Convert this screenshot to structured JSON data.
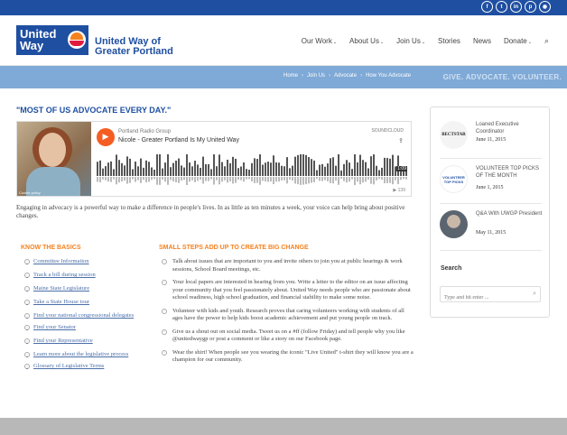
{
  "social": [
    "f",
    "t",
    "in",
    "p",
    "rss"
  ],
  "social_icons": [
    "facebook-icon",
    "twitter-icon",
    "linkedin-icon",
    "pinterest-icon",
    "rss-icon"
  ],
  "logo": {
    "text": "United Way",
    "org_name": "United Way of Greater Portland"
  },
  "nav": [
    {
      "label": "Our Work",
      "dropdown": true
    },
    {
      "label": "About Us",
      "dropdown": true
    },
    {
      "label": "Join Us",
      "dropdown": true
    },
    {
      "label": "Stories",
      "dropdown": false
    },
    {
      "label": "News",
      "dropdown": false
    },
    {
      "label": "Donate",
      "dropdown": true
    }
  ],
  "breadcrumb": [
    "Home",
    "Join Us",
    "Advocate",
    "How You Advocate"
  ],
  "tagline": "GIVE. ADVOCATE. VOLUNTEER.",
  "page_title": "\"MOST OF US ADVOCATE EVERY DAY.\"",
  "player": {
    "group": "Portland Radio Group",
    "track": "Nicole - Greater Portland Is My United Way",
    "brand": "SOUNDCLOUD",
    "duration": "1:09",
    "plays": "▶ 139",
    "photo_credit": "Cookie policy"
  },
  "intro": "Engaging in advocacy is a powerful way to make a difference in people's lives. In as little as ten minutes a week, your voice can help bring about positive changes.",
  "basics": {
    "heading": "KNOW THE BASICS",
    "links": [
      "Committee Information",
      "Track a bill during session",
      "Maine State Legislature",
      "Take a State House tour",
      "Find your national congressional delegates",
      "Find your Senator",
      "Find your Representative",
      "Learn more about the legislative process",
      "Glossary of Legislative Terms"
    ]
  },
  "steps": {
    "heading": "SMALL STEPS ADD UP TO CREATE BIG CHANGE",
    "items": [
      "Talk about issues that are important to you and invite others to join you at public hearings & work sessions, School Board meetings, etc.",
      "Your local papers are interested in hearing from you. Write a letter to the editor on an issue affecting your community that you feel passionately about. United Way needs people who are passionate about school readiness, high school graduation, and financial stability to make some noise.",
      "Volunteer with kids and youth. Research proves that caring volunteers working with students of all ages have the power to help kids boost academic achievement and put young people on track.",
      "Give us a shout out on social media. Tweet us on a #ff (follow Friday) and tell people why you like @unitedwaygp or post a comment or like a story on our Facebook page.",
      "Wear the shirt! When people see you wearing the iconic \"Live United\" t-shirt they will know you are a champion for our community."
    ]
  },
  "sidebar": {
    "posts": [
      {
        "title": "Loaned Executive Coordinator",
        "date": "June 11, 2015",
        "thumb_text": "BECTSTAR"
      },
      {
        "title": "VOLUNTEER TOP PICKS OF THE MONTH",
        "date": "June 1, 2015",
        "thumb_text": "VOLUNTEER TOP PICKS"
      },
      {
        "title": "Q&A With UWGP President",
        "date": "May 11, 2015",
        "thumb_text": ""
      }
    ],
    "search_heading": "Search",
    "search_placeholder": "Type and hit enter ..."
  },
  "colors": {
    "brand_blue": "#1f4fa1",
    "accent_orange": "#f58220",
    "band": "#7fa9d6",
    "link": "#4a6ea9"
  }
}
